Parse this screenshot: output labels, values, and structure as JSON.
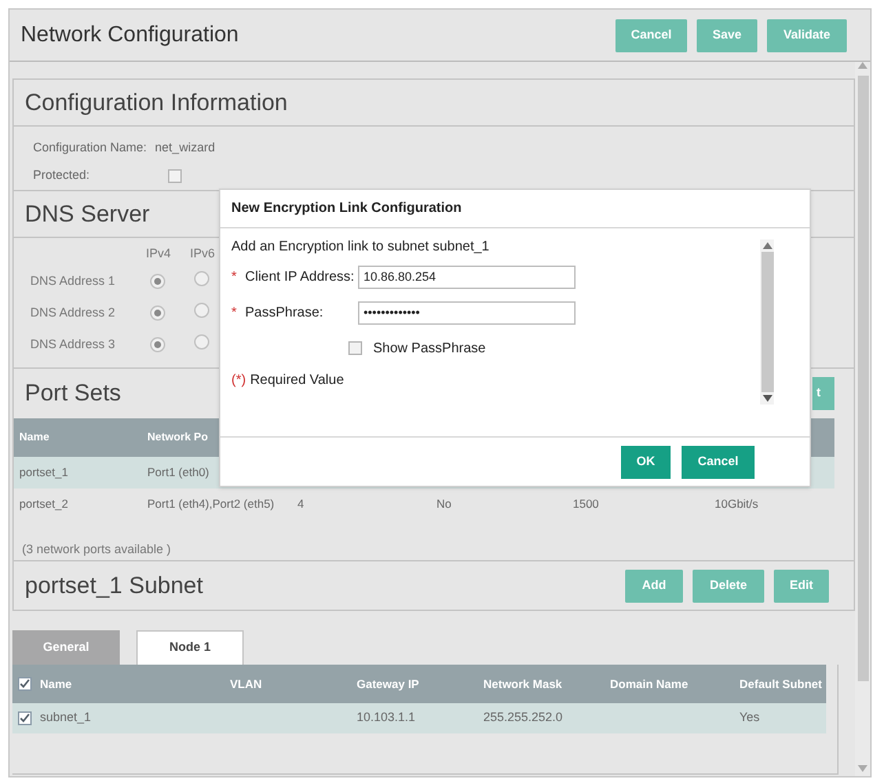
{
  "header": {
    "title": "Network Configuration",
    "buttons": [
      "Cancel",
      "Save",
      "Validate"
    ]
  },
  "config_info": {
    "title": "Configuration Information",
    "name_label": "Configuration Name:",
    "name_value": "net_wizard",
    "protected_label": "Protected:",
    "protected": false
  },
  "dns_server": {
    "title": "DNS Server",
    "columns": [
      "IPv4",
      "IPv6"
    ],
    "rows": [
      {
        "label": "DNS Address 1",
        "ipv4": true,
        "ipv6": false
      },
      {
        "label": "DNS Address 2",
        "ipv4": true,
        "ipv6": false
      },
      {
        "label": "DNS Address 3",
        "ipv4": true,
        "ipv6": false
      }
    ]
  },
  "port_sets": {
    "title": "Port Sets",
    "button": "t",
    "columns": [
      "Name",
      "Network Po"
    ],
    "rows": [
      {
        "selected": true,
        "cells": [
          "portset_1",
          "Port1 (eth0)"
        ]
      },
      {
        "selected": false,
        "cells": [
          "portset_2",
          "Port1 (eth4),Port2 (eth5)",
          "4",
          "No",
          "1500",
          "10Gbit/s"
        ]
      }
    ],
    "note": "(3 network ports available )"
  },
  "subnet": {
    "title": "portset_1 Subnet",
    "buttons": [
      "Add",
      "Delete",
      "Edit"
    ],
    "tabs": [
      {
        "label": "General",
        "selected": false
      },
      {
        "label": "Node 1",
        "selected": true
      }
    ],
    "columns": [
      "Name",
      "VLAN",
      "Gateway IP",
      "Network Mask",
      "Domain Name",
      "Default Subnet"
    ],
    "all_checked": true,
    "rows": [
      {
        "checked": true,
        "selected": true,
        "name": "subnet_1",
        "gateway_ip": "10.103.1.1",
        "network_mask": "255.255.252.0",
        "default_subnet": "Yes"
      }
    ]
  },
  "dialog": {
    "title": "New Encryption Link Configuration",
    "intro": "Add an Encryption link to subnet subnet_1",
    "required_mark": "*",
    "fields": [
      {
        "label": "Client IP Address:",
        "value": "10.86.80.254",
        "required": true
      },
      {
        "label": "PassPhrase:",
        "value": "•••••••••••••",
        "required": true
      }
    ],
    "show_passphrase": {
      "label": "Show PassPhrase",
      "checked": false
    },
    "required_note_mark": "(*)",
    "required_note": "Required Value",
    "buttons": [
      "OK",
      "Cancel"
    ]
  }
}
